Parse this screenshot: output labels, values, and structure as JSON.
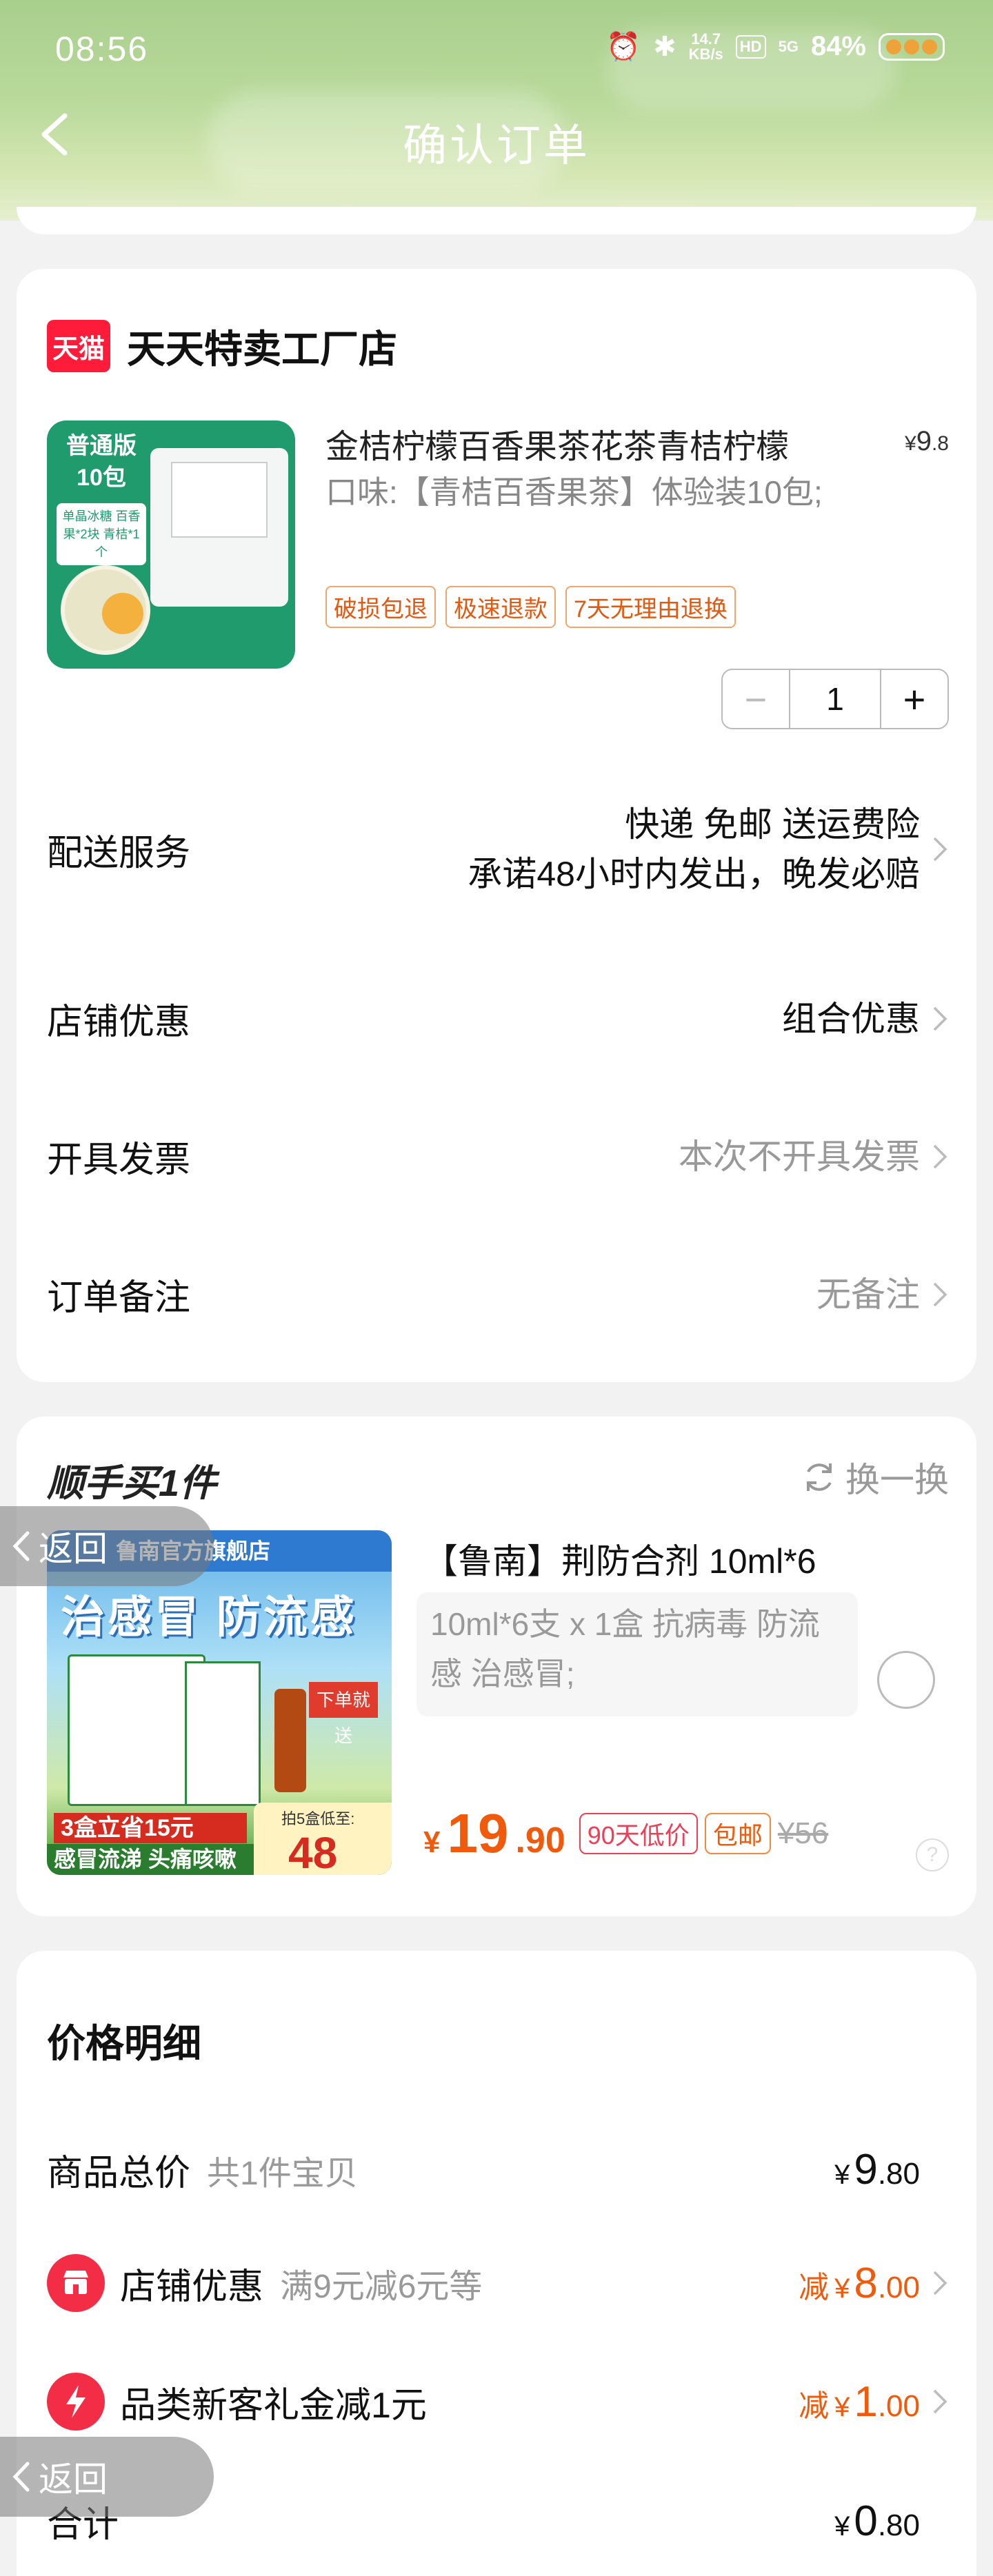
{
  "status_bar": {
    "time": "08:56",
    "net_speed_top": "14.7",
    "net_speed_bottom": "KB/s",
    "hd": "HD",
    "signal": "5G",
    "battery": "84%"
  },
  "header": {
    "title": "确认订单"
  },
  "store": {
    "logo_text": "天猫",
    "name": "天天特卖工厂店",
    "product": {
      "image_badge_1": "普通版",
      "image_badge_2": "10包",
      "image_note": "单晶冰糖 百香果*2块 青桔*1个",
      "title": "金桔柠檬百香果茶花茶青桔柠檬",
      "price_currency": "¥",
      "price_int": "9",
      "price_dec": ".8",
      "spec": "口味:【青桔百香果茶】体验装10包;",
      "tags": [
        "破损包退",
        "极速退款",
        "7天无理由退换"
      ],
      "quantity": "1"
    },
    "rows": {
      "delivery_label": "配送服务",
      "delivery_line1": "快递 免邮 送运费险",
      "delivery_line2": "承诺48小时内发出，晚发必赔",
      "discount_label": "店铺优惠",
      "discount_value": "组合优惠",
      "invoice_label": "开具发票",
      "invoice_value": "本次不开具发票",
      "note_label": "订单备注",
      "note_value": "无备注"
    }
  },
  "addon": {
    "title": "顺手买1件",
    "refresh_label": "换一换",
    "image_shop": "鲁南官方旗舰店",
    "image_headline": "治感冒 防流感",
    "image_gift": "下单就送",
    "image_promo": "3盒立省15元",
    "image_tagline": "感冒流涕 头痛咳嗽",
    "image_price_label": "拍5盒低至:",
    "image_price_value": "48",
    "name": "【鲁南】荆防合剂 10ml*6",
    "desc": "10ml*6支 x 1盒 抗病毒 防流感 治感冒;",
    "price_currency": "¥",
    "price_int": "19",
    "price_dec": ".90",
    "tag_low": "90天低价",
    "tag_ship": "包邮",
    "orig_price": "¥56",
    "help": "?"
  },
  "float_back": {
    "label": "返回"
  },
  "price_detail": {
    "title": "价格明细",
    "total_label": "商品总价",
    "total_sub": "共1件宝贝",
    "total_cur": "¥",
    "total_int": "9",
    "total_dec": ".80",
    "shop_discount_label": "店铺优惠",
    "shop_discount_sub": "满9元减6元等",
    "shop_discount_prefix": "减",
    "shop_discount_cur": "¥",
    "shop_discount_int": "8",
    "shop_discount_dec": ".00",
    "new_customer_label": "品类新客礼金减1元",
    "new_customer_prefix": "减",
    "new_customer_cur": "¥",
    "new_customer_int": "1",
    "new_customer_dec": ".00",
    "sum_label": "合计",
    "sum_cur": "¥",
    "sum_int": "0",
    "sum_dec": ".80"
  },
  "colors": {
    "accent_orange": "#f05a0a",
    "tmall_red": "#ff1c3a",
    "header_green": "#b8d99a"
  }
}
